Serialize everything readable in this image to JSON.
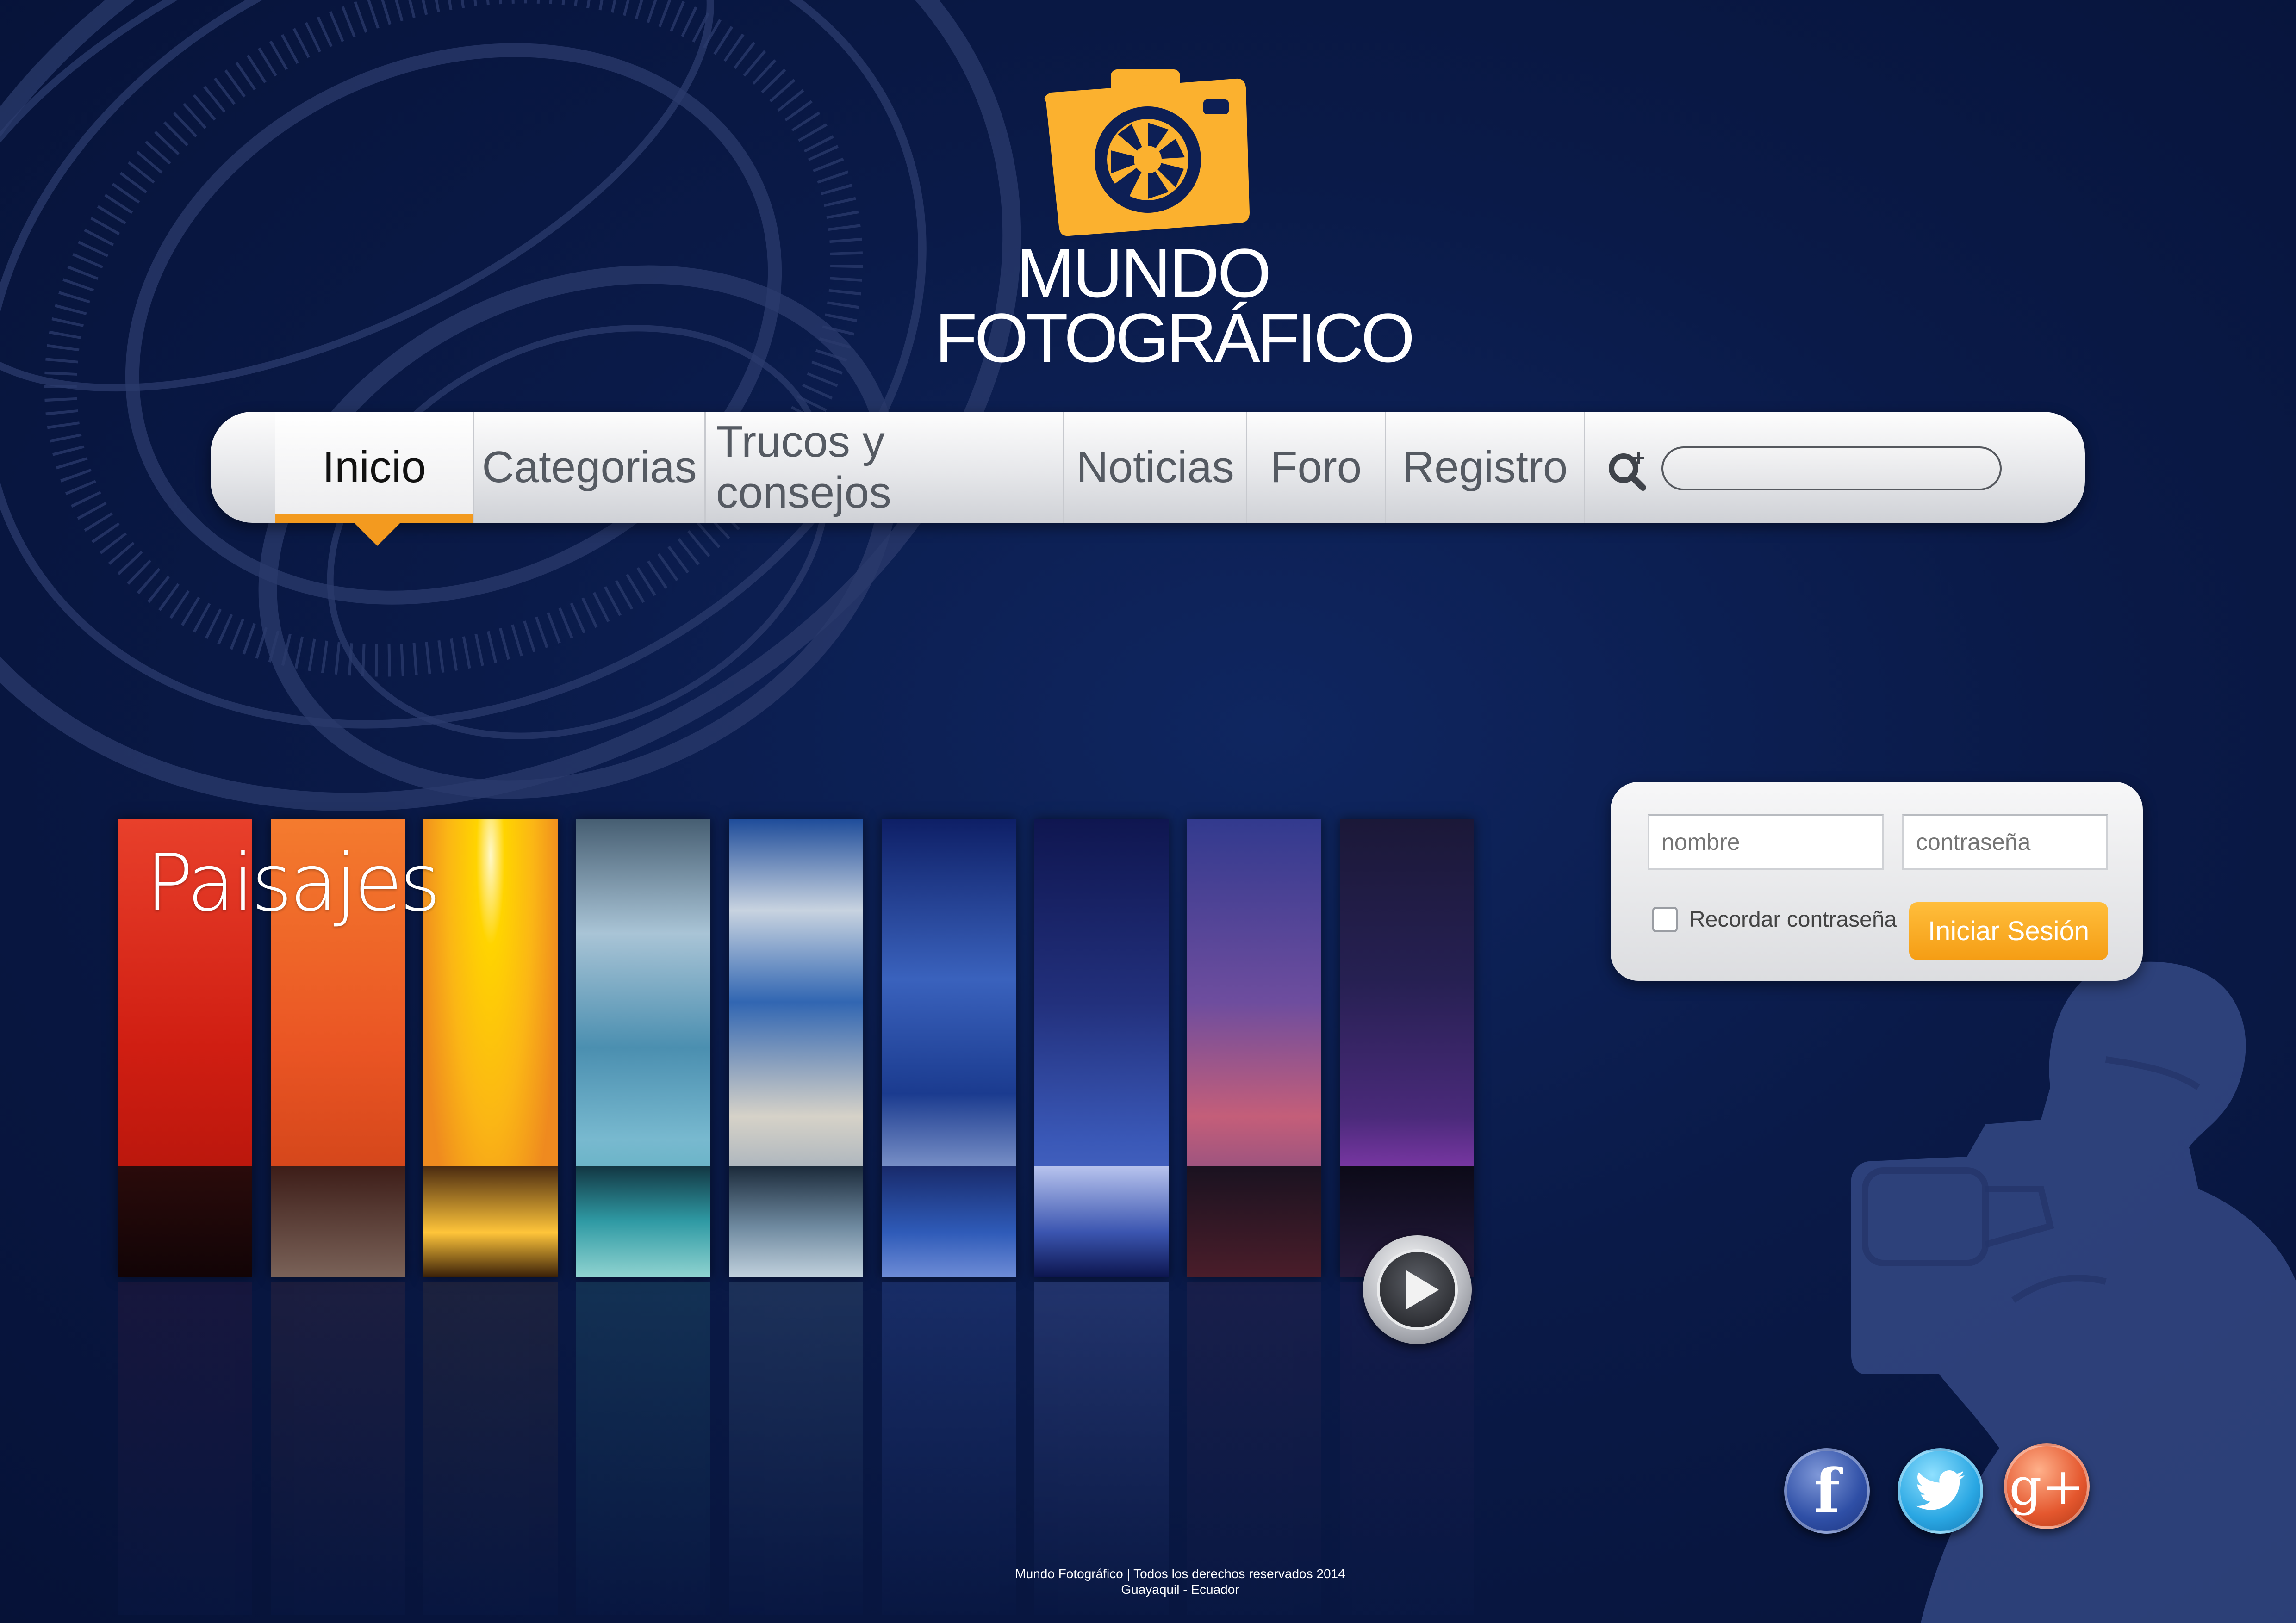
{
  "logo": {
    "line1": "MUNDO",
    "line2": "FOTOGRÁFICO",
    "icon": "camera-icon",
    "accent_color": "#fbb12f"
  },
  "nav": {
    "items": [
      {
        "label": "Inicio",
        "active": true
      },
      {
        "label": "Categorias"
      },
      {
        "label": "Trucos y consejos"
      },
      {
        "label": "Noticias"
      },
      {
        "label": "Foro"
      },
      {
        "label": "Registro"
      }
    ],
    "search_icon": "search-icon",
    "search_value": "",
    "active_color": "#f39a1f"
  },
  "gallery": {
    "title": "Paisajes",
    "strips": [
      {
        "top": "#ef3a2b",
        "bottom": "#c2160e"
      },
      {
        "top": "#f46d2a",
        "bottom": "#c64a16"
      },
      {
        "top": "#fdb914",
        "bottom": "#f0911b"
      },
      {
        "top": "#5e8fa8",
        "bottom": "#2fa8b5"
      },
      {
        "top": "#2c5aa8",
        "bottom": "#7b92b0"
      },
      {
        "top": "#2b49a0",
        "bottom": "#1e3a8a"
      },
      {
        "top": "#1d2e7c",
        "bottom": "#3856b8"
      },
      {
        "top": "#3b3f8f",
        "bottom": "#8a3c5f"
      },
      {
        "top": "#1c1640",
        "bottom": "#7a3aa5"
      }
    ],
    "play_icon": "play-icon"
  },
  "login": {
    "username_placeholder": "nombre",
    "password_placeholder": "contraseña",
    "remember_label": "Recordar contraseña",
    "submit_label": "Iniciar Sesión",
    "button_color": "#fbad25"
  },
  "social": {
    "facebook": {
      "icon": "facebook-icon",
      "glyph": "f",
      "color": "#2f4fa6"
    },
    "twitter": {
      "icon": "twitter-icon",
      "color": "#2aa7e3"
    },
    "googleplus": {
      "icon": "google-plus-icon",
      "glyph": "g+",
      "color": "#e4572e"
    }
  },
  "footer": {
    "line1": "Mundo Fotográfico | Todos los derechos reservados 2014",
    "line2": "Guayaquil - Ecuador"
  }
}
